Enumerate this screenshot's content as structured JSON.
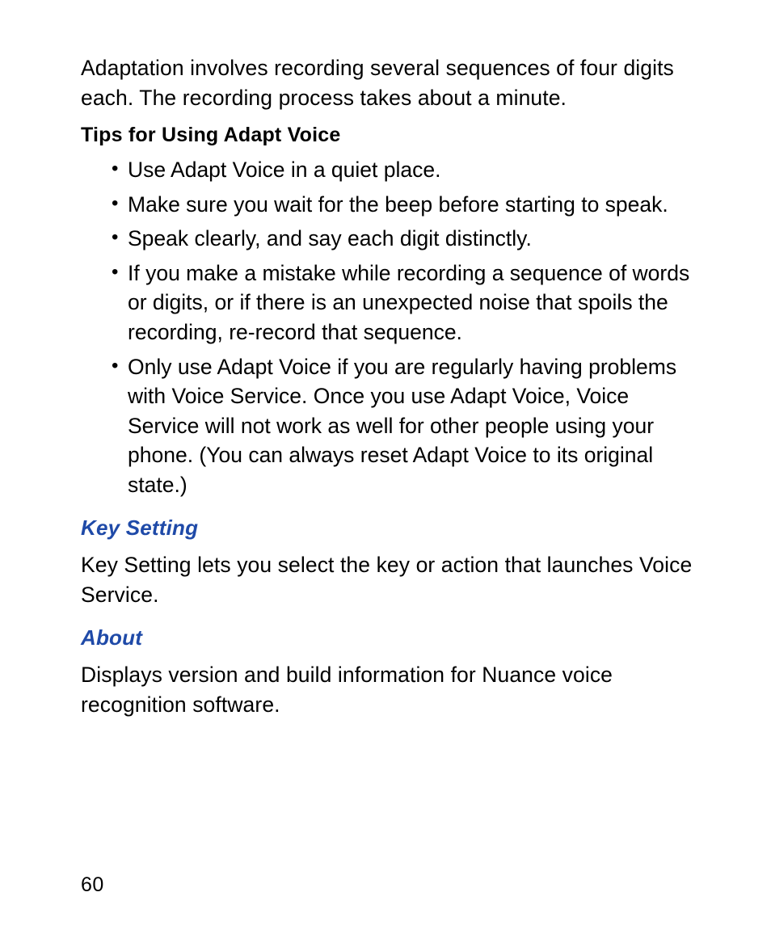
{
  "intro": "Adaptation involves recording several sequences of four digits each. The recording process takes about a minute.",
  "tips_heading": "Tips for Using Adapt Voice",
  "tips": [
    "Use Adapt Voice in a quiet place.",
    "Make sure you wait for the beep before starting to speak.",
    "Speak clearly, and say each digit distinctly.",
    "If you make a mistake while recording a sequence of words or digits, or if there is an unexpected noise that spoils the recording, re-record that sequence.",
    "Only use Adapt Voice if you are regularly having problems with Voice Service. Once you use Adapt Voice, Voice Service will not work as well for other people using your phone. (You can always reset Adapt Voice to its original state.)"
  ],
  "sections": [
    {
      "heading": "Key Setting",
      "body": "Key Setting lets you select the key or action that launches Voice Service."
    },
    {
      "heading": "About",
      "body": "Displays version and build information for Nuance voice recognition software."
    }
  ],
  "page_number": "60"
}
